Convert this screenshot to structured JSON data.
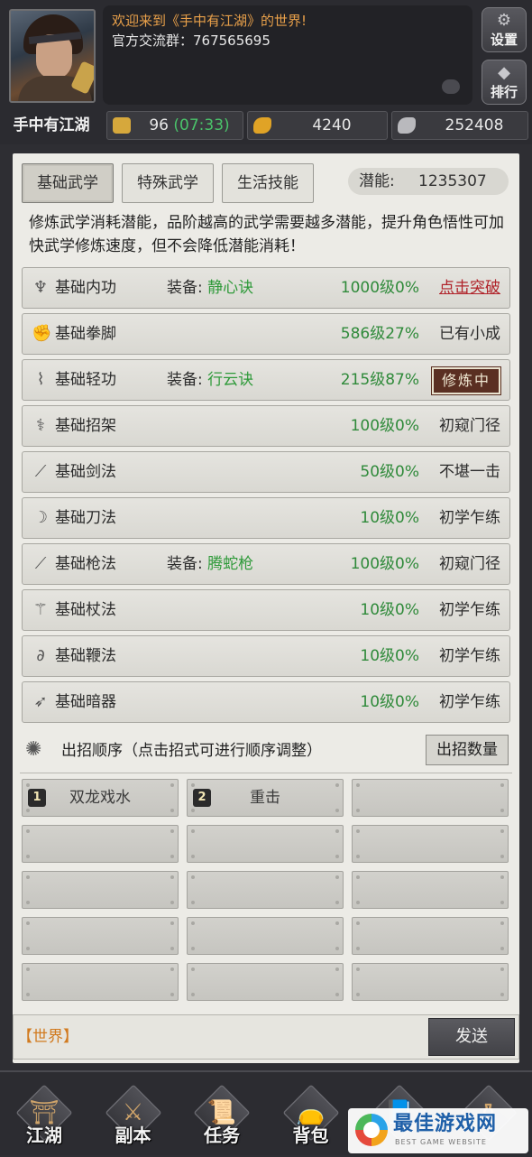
{
  "header": {
    "welcome_line1": "欢迎来到《手中有江湖》的世界!",
    "welcome_line2": "官方交流群：767565695",
    "player_name": "手中有江湖",
    "settings_label": "设置",
    "ranking_label": "排行",
    "resources": {
      "stamina": "96",
      "stamina_timer": "(07:33)",
      "gold": "4240",
      "silver": "252408"
    }
  },
  "tabs": [
    {
      "label": "基础武学",
      "active": true
    },
    {
      "label": "特殊武学",
      "active": false
    },
    {
      "label": "生活技能",
      "active": false
    }
  ],
  "potential": {
    "label": "潜能:",
    "value": "1235307"
  },
  "description": "修炼武学消耗潜能，品阶越高的武学需要越多潜能，提升角色悟性可加快武学修炼速度，但不会降低潜能消耗！",
  "skills": [
    {
      "icon": "fist-aura-icon",
      "name": "基础内功",
      "equip_label": "装备:",
      "equip_name": "静心诀",
      "level": "1000级0%",
      "status": "点击突破",
      "status_type": "break"
    },
    {
      "icon": "fist-icon",
      "name": "基础拳脚",
      "equip_label": "",
      "equip_name": "",
      "level": "586级27%",
      "status": "已有小成",
      "status_type": "text"
    },
    {
      "icon": "boot-icon",
      "name": "基础轻功",
      "equip_label": "装备:",
      "equip_name": "行云诀",
      "level": "215级87%",
      "status": "修炼中",
      "status_type": "stamp"
    },
    {
      "icon": "parry-arm-icon",
      "name": "基础招架",
      "equip_label": "",
      "equip_name": "",
      "level": "100级0%",
      "status": "初窥门径",
      "status_type": "text"
    },
    {
      "icon": "sword-icon",
      "name": "基础剑法",
      "equip_label": "",
      "equip_name": "",
      "level": "50级0%",
      "status": "不堪一击",
      "status_type": "text"
    },
    {
      "icon": "blade-icon",
      "name": "基础刀法",
      "equip_label": "",
      "equip_name": "",
      "level": "10级0%",
      "status": "初学乍练",
      "status_type": "text"
    },
    {
      "icon": "spear-icon",
      "name": "基础枪法",
      "equip_label": "装备:",
      "equip_name": "腾蛇枪",
      "level": "100级0%",
      "status": "初窥门径",
      "status_type": "text"
    },
    {
      "icon": "staff-icon",
      "name": "基础杖法",
      "equip_label": "",
      "equip_name": "",
      "level": "10级0%",
      "status": "初学乍练",
      "status_type": "text"
    },
    {
      "icon": "whip-icon",
      "name": "基础鞭法",
      "equip_label": "",
      "equip_name": "",
      "level": "10级0%",
      "status": "初学乍练",
      "status_type": "text"
    },
    {
      "icon": "dart-icon",
      "name": "基础暗器",
      "equip_label": "",
      "equip_name": "",
      "level": "10级0%",
      "status": "初学乍练",
      "status_type": "text"
    }
  ],
  "move_order": {
    "title": "出招顺序（点击招式可进行顺序调整）",
    "count_button": "出招数量",
    "slots": [
      {
        "num": "1",
        "label": "双龙戏水"
      },
      {
        "num": "2",
        "label": "重击"
      }
    ]
  },
  "chat": {
    "channel": "【世界】",
    "send_label": "发送"
  },
  "nav": [
    {
      "label": "江湖",
      "icon": "pagoda-icon"
    },
    {
      "label": "副本",
      "icon": "crossed-weapons-icon"
    },
    {
      "label": "任务",
      "icon": "scroll-icon"
    },
    {
      "label": "背包",
      "icon": "pouch-icon"
    },
    {
      "label": "",
      "icon": "book-icon"
    },
    {
      "label": "",
      "icon": "gourd-icon"
    }
  ],
  "watermark": {
    "title": "最佳游戏网",
    "subtitle": "BEST GAME WEBSITE"
  },
  "colors": {
    "accent_orange": "#e8a04a",
    "green_level": "#2f8a3a",
    "red_break": "#b0232a",
    "timer_green": "#4ac36a"
  }
}
